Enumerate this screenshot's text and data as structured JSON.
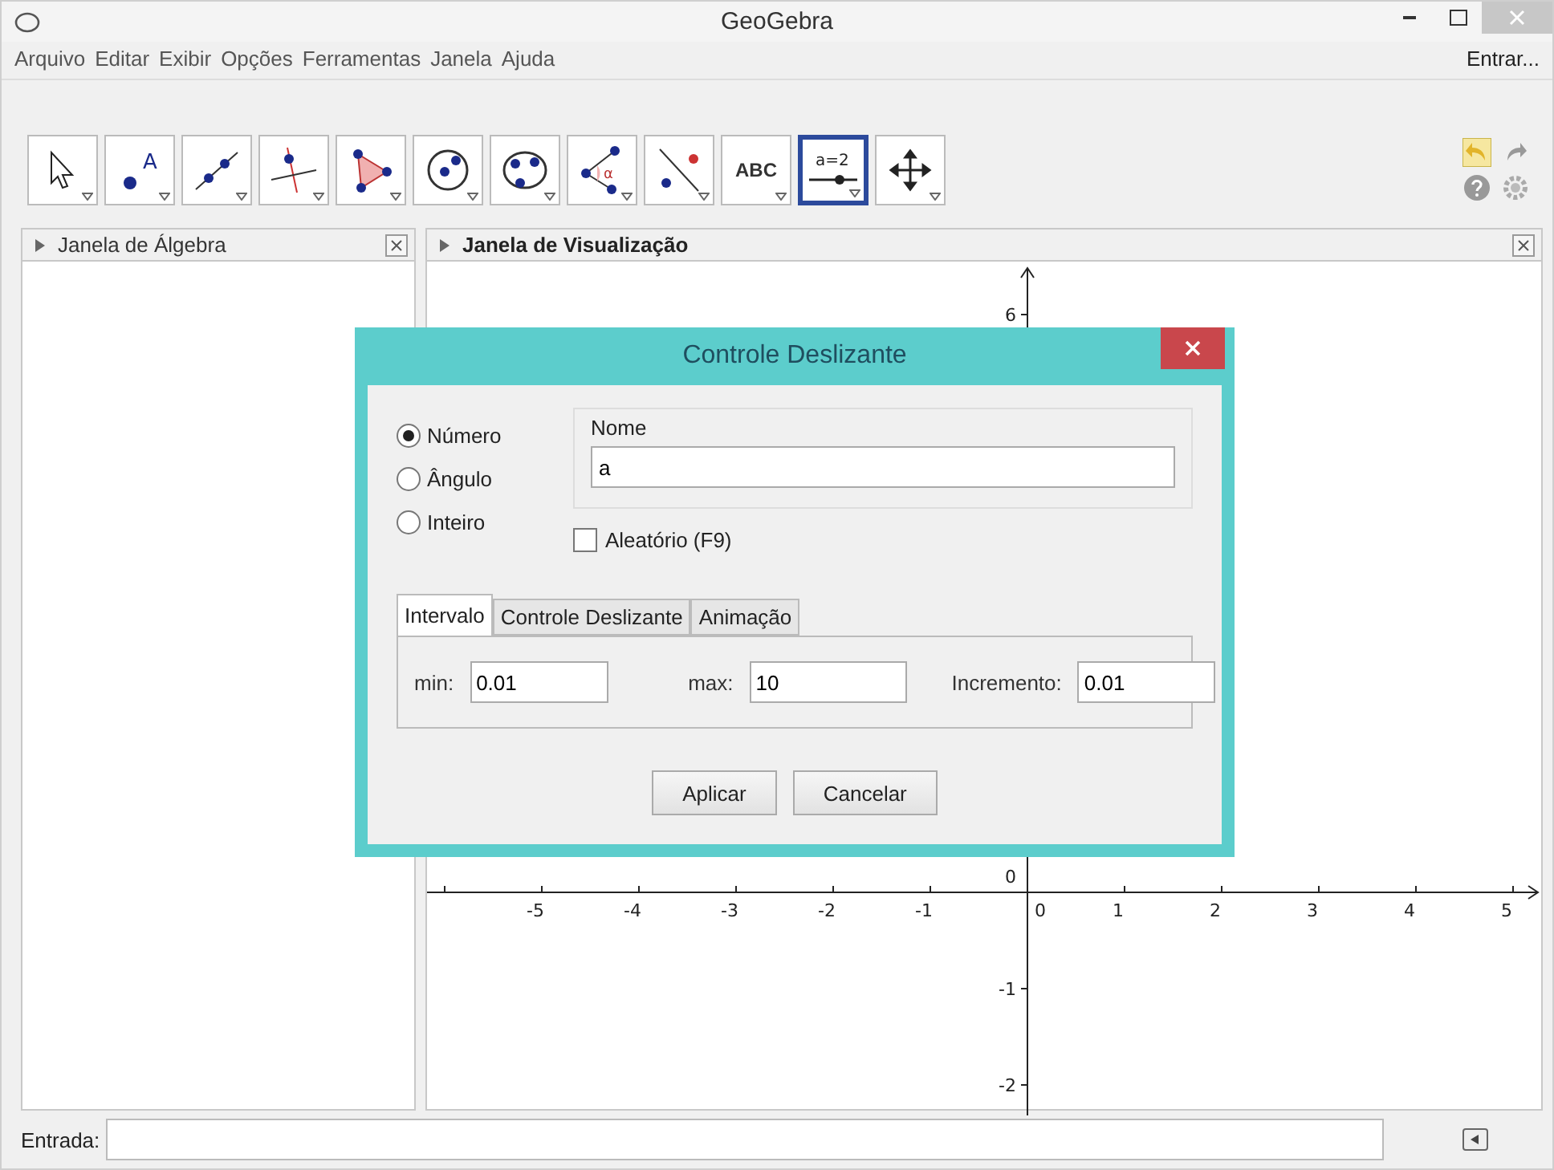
{
  "window": {
    "title": "GeoGebra"
  },
  "menu": [
    "Arquivo",
    "Editar",
    "Exibir",
    "Opções",
    "Ferramentas",
    "Janela",
    "Ajuda"
  ],
  "login": "Entrar...",
  "tools": [
    {
      "kind": "pointer",
      "selected": false
    },
    {
      "kind": "point",
      "label": "A",
      "selected": false
    },
    {
      "kind": "line",
      "selected": false
    },
    {
      "kind": "perpendicular",
      "selected": false
    },
    {
      "kind": "polygon",
      "selected": false
    },
    {
      "kind": "circle",
      "selected": false
    },
    {
      "kind": "ellipse",
      "selected": false
    },
    {
      "kind": "angle",
      "label": "α",
      "selected": false
    },
    {
      "kind": "reflect",
      "selected": false
    },
    {
      "kind": "text",
      "label": "ABC",
      "selected": false
    },
    {
      "kind": "slider",
      "label": "a=2",
      "selected": true
    },
    {
      "kind": "move",
      "selected": false
    }
  ],
  "algebra_panel": {
    "title": "Janela de Álgebra"
  },
  "graphics_panel": {
    "title": "Janela de Visualização",
    "x_labels": [
      "-5",
      "-4",
      "-3",
      "-2",
      "-1",
      "0",
      "1",
      "2",
      "3",
      "4",
      "5"
    ],
    "y_labels": [
      "6",
      "0",
      "-1",
      "-2"
    ]
  },
  "input_bar": {
    "label": "Entrada:"
  },
  "dialog": {
    "title": "Controle Deslizante",
    "types": [
      {
        "label": "Número",
        "selected": true
      },
      {
        "label": "Ângulo",
        "selected": false
      },
      {
        "label": "Inteiro",
        "selected": false
      }
    ],
    "name_group": "Nome",
    "name_value": "a",
    "random": {
      "label": "Aleatório (F9)",
      "checked": false
    },
    "tabs": [
      {
        "label": "Intervalo",
        "selected": true
      },
      {
        "label": "Controle Deslizante",
        "selected": false
      },
      {
        "label": "Animação",
        "selected": false
      }
    ],
    "fields": [
      {
        "label": "min:",
        "value": "0.01"
      },
      {
        "label": "max:",
        "value": "10"
      },
      {
        "label": "Incremento:",
        "value": "0.01"
      }
    ],
    "buttons": [
      "Aplicar",
      "Cancelar"
    ]
  }
}
